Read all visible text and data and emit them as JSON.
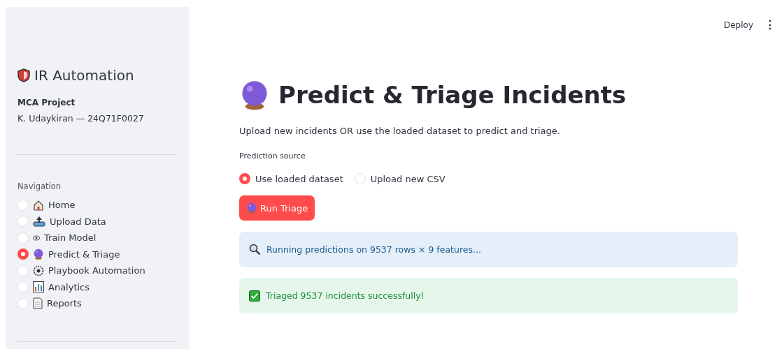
{
  "header": {
    "deploy": "Deploy",
    "menu": "⋮"
  },
  "sidebar": {
    "title": "IR Automation",
    "project": "MCA Project",
    "author": "K. Udaykiran — 24Q71F0027",
    "nav_label": "Navigation",
    "items": [
      {
        "label": "Home",
        "selected": false
      },
      {
        "label": "Upload Data",
        "selected": false
      },
      {
        "label": "Train Model",
        "selected": false
      },
      {
        "label": "Predict & Triage",
        "selected": true
      },
      {
        "label": "Playbook Automation",
        "selected": false
      },
      {
        "label": "Analytics",
        "selected": false
      },
      {
        "label": "Reports",
        "selected": false
      }
    ]
  },
  "main": {
    "title": "Predict & Triage Incidents",
    "subtitle": "Upload new incidents OR use the loaded dataset to predict and triage.",
    "source_label": "Prediction source",
    "options": [
      {
        "label": "Use loaded dataset",
        "selected": true
      },
      {
        "label": "Upload new CSV",
        "selected": false
      }
    ],
    "button": "Run Triage",
    "alerts": [
      {
        "kind": "info",
        "text": "Running predictions on 9537 rows × 9 features..."
      },
      {
        "kind": "success",
        "text": "Triaged 9537 incidents successfully!"
      }
    ]
  }
}
